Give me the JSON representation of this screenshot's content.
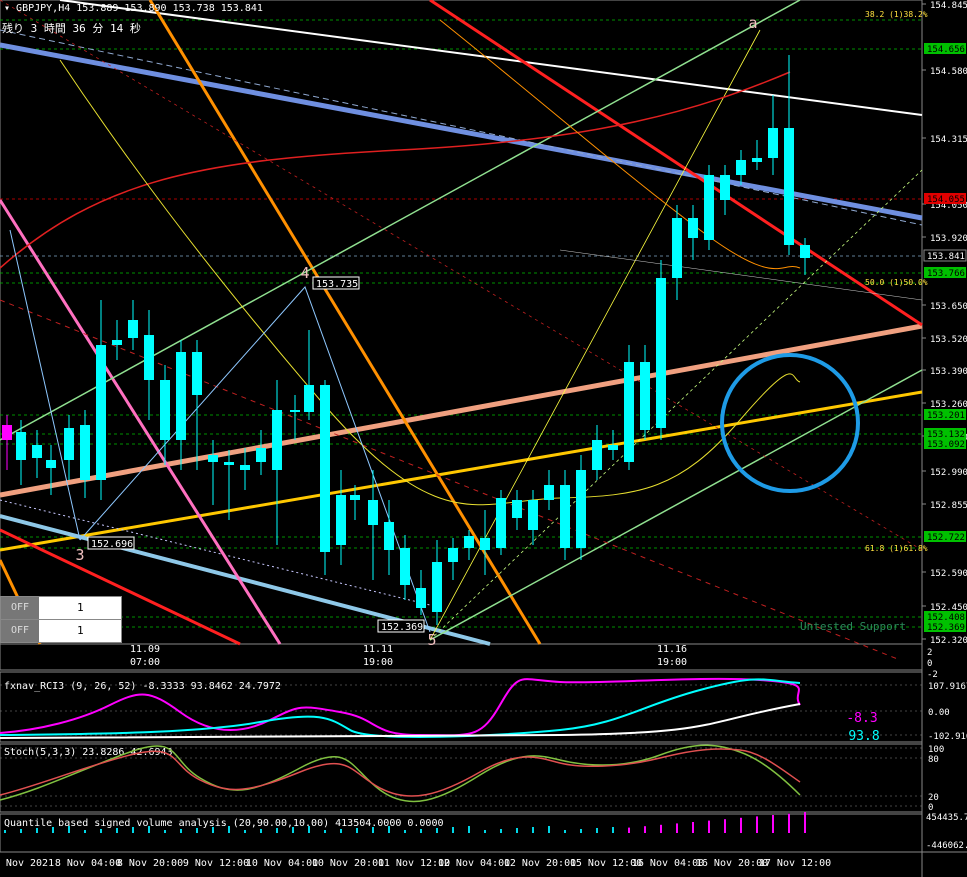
{
  "header": {
    "symbol_line": "GBPJPY,H4  153.889 153.890 153.738 153.841",
    "countdown": "残り 3 時間 36 分 14 秒"
  },
  "price_axis": {
    "labels": [
      "154.845",
      "154.580",
      "154.315",
      "154.050",
      "153.920",
      "153.650",
      "153.520",
      "153.390",
      "153.260",
      "153.130",
      "152.990",
      "152.855",
      "152.590",
      "152.450",
      "152.320"
    ],
    "tags": [
      {
        "text": "154.656",
        "bg": "#00c000",
        "fg": "#000"
      },
      {
        "text": "154.055",
        "bg": "#e00000",
        "fg": "#000"
      },
      {
        "text": "153.841",
        "bg": "#000",
        "fg": "#fff"
      },
      {
        "text": "153.766",
        "bg": "#00c000",
        "fg": "#000"
      },
      {
        "text": "153.201",
        "bg": "#00c000",
        "fg": "#000"
      },
      {
        "text": "153.132",
        "bg": "#00c000",
        "fg": "#000"
      },
      {
        "text": "153.092",
        "bg": "#00c000",
        "fg": "#000"
      },
      {
        "text": "152.722",
        "bg": "#00c000",
        "fg": "#000"
      },
      {
        "text": "152.408",
        "bg": "#00c000",
        "fg": "#000"
      },
      {
        "text": "152.369",
        "bg": "#00c000",
        "fg": "#000"
      }
    ]
  },
  "fib_labels": {
    "f382": "38.2 (1)38.2%",
    "f500": "50.0 (1)50.0%",
    "f618": "61.8 (1)61.8%"
  },
  "wave_labels": {
    "w4": "4",
    "w3": "3",
    "w5": "5",
    "wa": "a"
  },
  "price_callouts": {
    "c4": "153.735",
    "c3": "152.696",
    "c5": "152.369"
  },
  "support_text": "Untested Support",
  "time_labels_main": {
    "t1": "11.09",
    "t1b": "07:00",
    "t2": "11.11",
    "t2b": "19:00",
    "t3": "11.16",
    "t3b": "19:00"
  },
  "mini_axis": {
    "top": "2",
    "mid": "0",
    "bot": "-2"
  },
  "rci": {
    "title": "fxnav_RCI3 (9, 26, 52) -8.3333 93.8462 24.7972",
    "axis": [
      "107.9167",
      "0.00",
      "-102.9167"
    ],
    "value1": "-8.3",
    "value2": "93.8",
    "color1": "#ff00ff",
    "color2": "#00ffff"
  },
  "stoch": {
    "title": "Stoch(5,3,3) 23.8286 42.6943",
    "axis": [
      "100",
      "80",
      "20",
      "0"
    ]
  },
  "volume": {
    "title": "Quantile based signed volume analysis (20,90.00,10.00) 413504.0000 0.0000",
    "axis": [
      "454435.75",
      "-446062.2"
    ]
  },
  "time_axis": [
    "5 Nov 2021",
    "8 Nov 04:00",
    "8 Nov 20:00",
    "9 Nov 12:00",
    "10 Nov 04:00",
    "10 Nov 20:00",
    "11 Nov 12:00",
    "12 Nov 04:00",
    "12 Nov 20:00",
    "15 Nov 12:00",
    "16 Nov 04:00",
    "16 Nov 20:00",
    "17 Nov 12:00"
  ],
  "off_buttons": [
    {
      "label": "OFF",
      "value": "1"
    },
    {
      "label": "OFF",
      "value": "1"
    }
  ],
  "colors": {
    "bull": "#ff00ff",
    "bear": "#00ffff",
    "accent_circle": "#1e9be6"
  }
}
